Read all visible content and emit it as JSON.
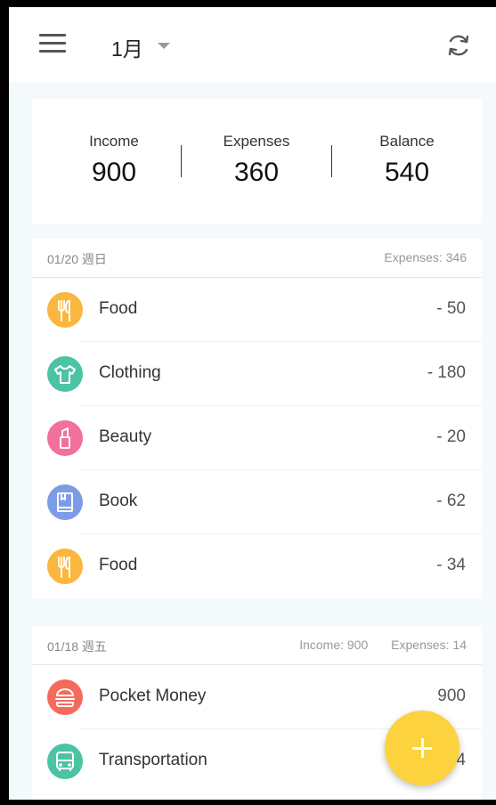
{
  "header": {
    "month": "1月",
    "menu_icon": "hamburger-menu-icon",
    "refresh_icon": "refresh-icon"
  },
  "summary": {
    "income_label": "Income",
    "income_value": "900",
    "expenses_label": "Expenses",
    "expenses_value": "360",
    "balance_label": "Balance",
    "balance_value": "540"
  },
  "days": [
    {
      "date": "01/20 週日",
      "income": "",
      "expenses": "Expenses: 346",
      "items": [
        {
          "icon": "utensils-icon",
          "color": "#fbb63f",
          "name": "Food",
          "amount": "- 50"
        },
        {
          "icon": "tshirt-icon",
          "color": "#4cc4a4",
          "name": "Clothing",
          "amount": "- 180"
        },
        {
          "icon": "lipstick-icon",
          "color": "#f2709c",
          "name": "Beauty",
          "amount": "- 20"
        },
        {
          "icon": "book-icon",
          "color": "#7d9ce8",
          "name": "Book",
          "amount": "- 62"
        },
        {
          "icon": "utensils-icon",
          "color": "#fbb63f",
          "name": "Food",
          "amount": "- 34"
        }
      ]
    },
    {
      "date": "01/18 週五",
      "income": "Income: 900",
      "expenses": "Expenses: 14",
      "items": [
        {
          "icon": "hamburger-food-icon",
          "color": "#f46b5b",
          "name": "Pocket Money",
          "amount": "900"
        },
        {
          "icon": "bus-icon",
          "color": "#4cc4a4",
          "name": "Transportation",
          "amount": "- 14"
        }
      ]
    }
  ],
  "fab_icon": "plus-icon"
}
